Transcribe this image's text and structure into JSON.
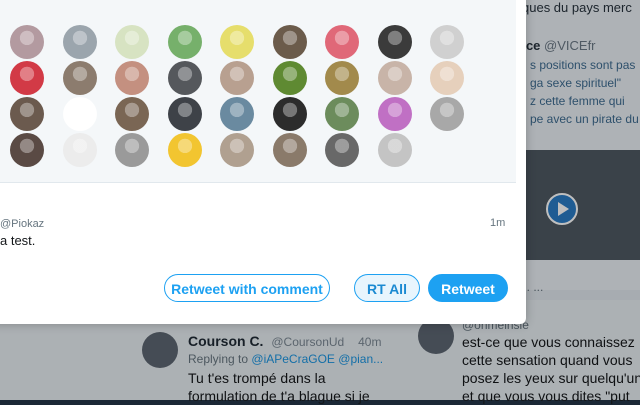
{
  "background": {
    "news_text": "ques du pays merc",
    "account_name": "nce",
    "account_handle": "@VICEfr",
    "lines": [
      "s positions sont pas",
      "ga sexe spirituel\"",
      "z cette femme qui",
      "pe avec un pirate du"
    ],
    "reply_meta": "@ohmeinsie",
    "tweet_name": "Courson C.",
    "tweet_handle": "@CoursonUd",
    "tweet_time": "40m",
    "tweet_reply_prefix": "Replying to",
    "tweet_reply_target": "@iAPeCraGOE @pian...",
    "tweet_text": "Tu t'es trompé dans la\nformulation de t'a blague si je",
    "right_tweet_text": "est-ce que vous connaissez\ncette sensation quand vous\nposez les yeux sur quelqu'un\net que vous vous dites \"put",
    "stats": "...    ..."
  },
  "modal": {
    "avatar_colors": [
      [
        "#b39aa0",
        "#9ba5ad",
        "#d7e3c2",
        "#76b06b",
        "#e6de6c",
        "#6b5b4b",
        "#e06878",
        "#3b3b3b",
        "#d0d0d0"
      ],
      [
        "#d23a46",
        "#8c7c6e",
        "#c49080",
        "#55585c",
        "#b8a090",
        "#5f8a32",
        "#a28a4c",
        "#c8b4a8",
        "#e6d0bc"
      ],
      [
        "#6b5a4e",
        "#ffffff",
        "#7a6654",
        "#3e4248",
        "#6a8aa0",
        "#2c2c2c",
        "#6c8c5c",
        "#c070c4",
        "#a8a8a8"
      ],
      [
        "#5a4a44",
        "#ececec",
        "#9a9a9a",
        "#f2c530",
        "#b0a090",
        "#8a7a6a",
        "#686868",
        "#c4c4c4"
      ]
    ],
    "quoted_handle": "@Piokaz",
    "quoted_time": "1m",
    "quoted_text": "a test.",
    "buttons": {
      "retweet_with_comment": "Retweet with comment",
      "rt_all": "RT All",
      "retweet": "Retweet"
    },
    "accent_color": "#1da1f2"
  }
}
